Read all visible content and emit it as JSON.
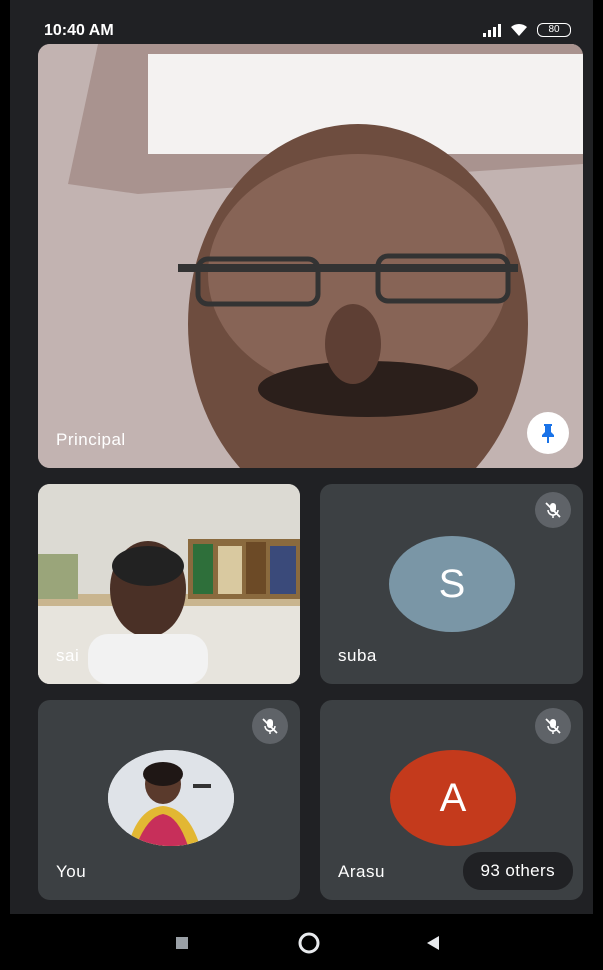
{
  "status_bar": {
    "time": "10:40 AM",
    "battery": "80"
  },
  "colors": {
    "background": "#202124",
    "tile": "#3c4043",
    "avatar_s": "#7a96a6",
    "avatar_a": "#c43a1c",
    "pin_icon": "#1a73e8"
  },
  "tiles": {
    "principal": {
      "name": "Principal",
      "icon": "pin-icon"
    },
    "sai": {
      "name": "sai"
    },
    "suba": {
      "name": "suba",
      "initial": "S",
      "icon": "mic-off-icon"
    },
    "you": {
      "name": "You",
      "icon": "mic-off-icon"
    },
    "arasu": {
      "name": "Arasu",
      "initial": "A",
      "icon": "mic-off-icon"
    }
  },
  "others_badge": {
    "label": "93 others"
  },
  "nav": {
    "back": "back-icon",
    "home": "home-icon",
    "recents": "recents-icon"
  }
}
